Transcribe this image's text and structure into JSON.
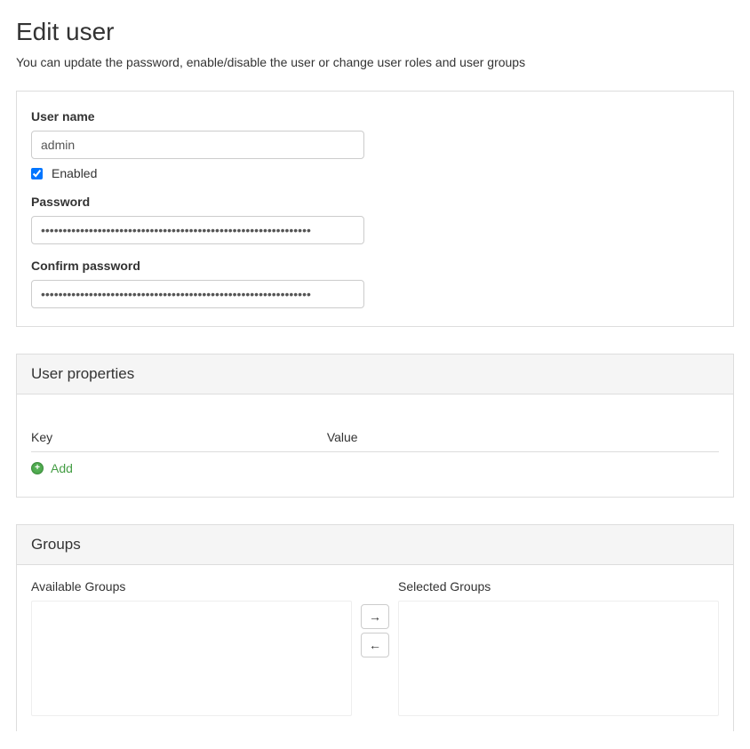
{
  "page": {
    "title": "Edit user",
    "description": "You can update the password, enable/disable the user or change user roles and user groups"
  },
  "user": {
    "username_label": "User name",
    "username_value": "admin",
    "enabled_label": "Enabled",
    "enabled_value": true,
    "password_label": "Password",
    "password_value": "••••••••••••••••••••••••••••••••••••••••••••••••••••••••••••••",
    "confirm_label": "Confirm password",
    "confirm_value": "••••••••••••••••••••••••••••••••••••••••••••••••••••••••••••••"
  },
  "properties": {
    "panel_title": "User properties",
    "key_header": "Key",
    "value_header": "Value",
    "add_label": "Add"
  },
  "groups": {
    "panel_title": "Groups",
    "available_label": "Available Groups",
    "selected_label": "Selected Groups",
    "move_right": "→",
    "move_left": "←"
  }
}
